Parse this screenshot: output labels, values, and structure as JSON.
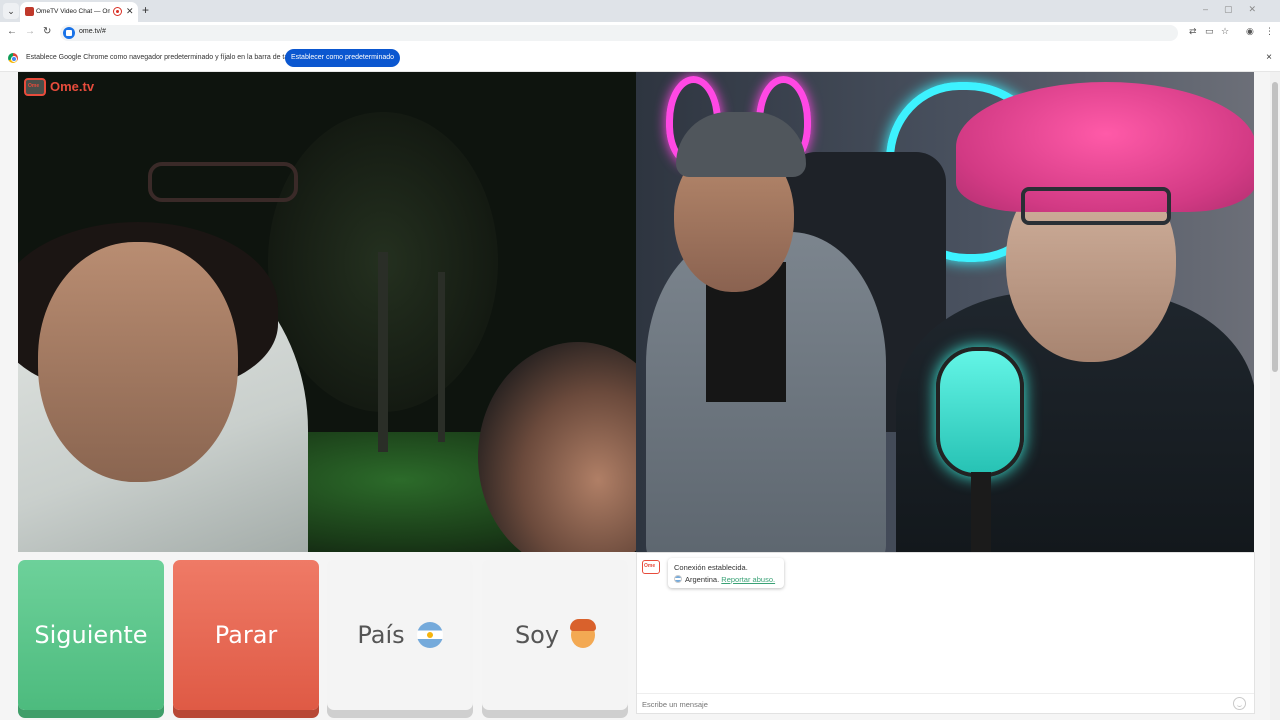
{
  "browser": {
    "tab_title": "OmeTV Video Chat — Ome",
    "new_tab_symbol": "+",
    "tab_close_symbol": "✕",
    "url": "ome.tv/#",
    "icons": [
      "translate-icon",
      "cast-icon",
      "bookmark-star-icon",
      "profile-icon",
      "menu-kebab-icon"
    ]
  },
  "infobar": {
    "message": "Establece Google Chrome como navegador predeterminado y fíjalo en la barra de tareas",
    "button_label": "Establecer como predeterminado",
    "close_symbol": "×"
  },
  "page": {
    "logo_text": "Ome.tv",
    "buttons": {
      "next": "Siguiente",
      "stop": "Parar",
      "country": "País",
      "gender": "Soy"
    },
    "chat": {
      "status_line": "Conexión establecida.",
      "country_text": "Argentina.",
      "report_link": "Reportar abuso.",
      "input_placeholder": "Escribe un mensaje"
    }
  },
  "colors": {
    "next_button": "#4dbb7e",
    "stop_button": "#df5a45",
    "brand_red": "#e74c3c",
    "infobar_button": "#0b57d0",
    "link_green": "#3aa276"
  }
}
